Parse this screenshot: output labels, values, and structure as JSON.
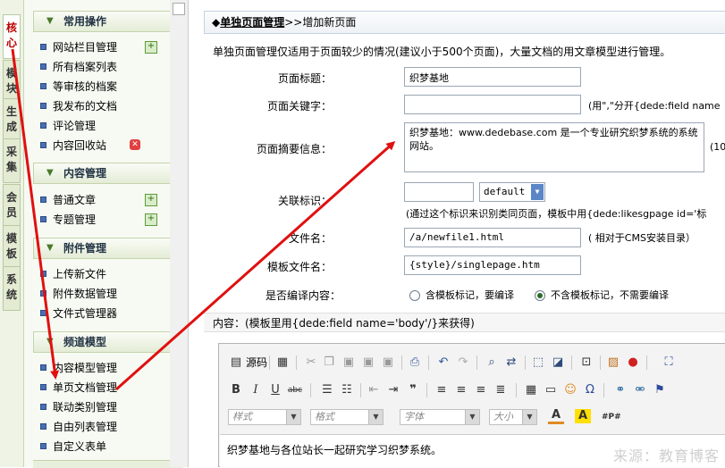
{
  "vtabs": [
    "核心",
    "模块",
    "生成",
    "采集",
    "会员",
    "模板",
    "系统"
  ],
  "sidebar": {
    "sections": [
      {
        "title": "常用操作",
        "items": [
          "网站栏目管理",
          "所有档案列表",
          "等审核的档案",
          "我发布的文档",
          "评论管理",
          "内容回收站"
        ]
      },
      {
        "title": "内容管理",
        "items": [
          "普通文章",
          "专题管理"
        ]
      },
      {
        "title": "附件管理",
        "items": [
          "上传新文件",
          "附件数据管理",
          "文件式管理器"
        ]
      },
      {
        "title": "频道模型",
        "items": [
          "内容模型管理",
          "单页文档管理",
          "联动类别管理",
          "自由列表管理",
          "自定义表单"
        ]
      }
    ]
  },
  "breadcrumb": {
    "prefix": "◆",
    "link": "单独页面管理",
    "sep": ">>",
    "current": "增加新页面"
  },
  "notice": "单独页面管理仅适用于页面较少的情况(建议小于500个页面)，大量文档的用文章模型进行管理。",
  "form": {
    "title_label": "页面标题：",
    "title_value": "织梦基地",
    "keywords_label": "页面关键字：",
    "keywords_value": "",
    "keywords_note": "(用\",\"分开{dede:field name",
    "summary_label": "页面摘要信息：",
    "summary_value": "织梦基地：www.dedebase.com 是一个专业研究织梦系统的系统网站。",
    "summary_note": "(10",
    "likeid_label": "关联标识：",
    "likeid_value": "",
    "likeid_select": "default",
    "likeid_note": "(通过这个标识来识别类同页面，模板中用{dede:likesgpage id='标",
    "filename_label": "文件名：",
    "filename_value": "{cmspath}/a/newfile1.html",
    "filename_value_shown": "/a/newfile1.html",
    "filename_note": "( 相对于CMS安装目录）",
    "template_label": "模板文件名：",
    "template_value": "{style}/singlepage.htm",
    "compile_label": "是否编译内容：",
    "compile_opt1": "含模板标记，要编译",
    "compile_opt2": "不含模板标记，不需要编译",
    "compile_selected": 2
  },
  "body_label": "内容：(模板里用{dede:field name='body'/}来获得)",
  "editor": {
    "source_label": "源码",
    "style_combo": "样式",
    "format_combo": "格式",
    "font_combo": "字体",
    "size_combo": "大小",
    "content": "织梦基地与各位站长一起研究学习织梦系统。"
  },
  "watermark": "来源：教育博客",
  "colors": {
    "arrow": "#e01010",
    "accent_green": "#4a7a2a",
    "active_tab_text": "#b00000"
  }
}
